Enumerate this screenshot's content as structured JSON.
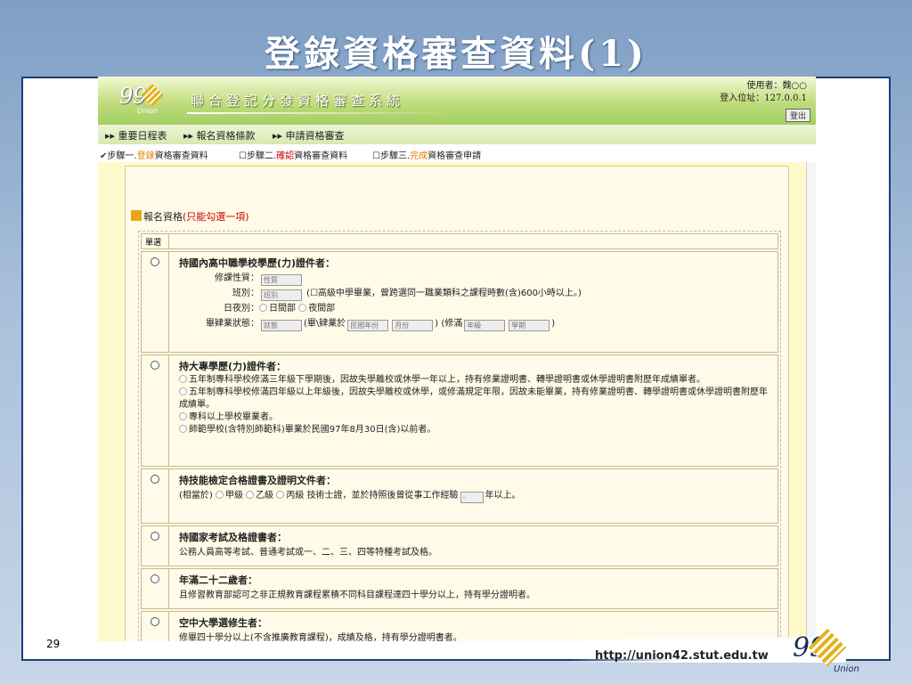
{
  "slide": {
    "title": "登錄資格審查資料(1)",
    "page_number": "29",
    "url": "http://union42.stut.edu.tw",
    "logo_number": "99",
    "logo_text": "Union"
  },
  "app": {
    "logo_number": "99",
    "logo_text": "Union",
    "system_title": "聯合登記分發資格審查系統",
    "user_label": "使用者：魏○○",
    "ip_label": "登入位址：",
    "ip_value": "127.0.0.1",
    "logout": "登出"
  },
  "menu": {
    "items": [
      "重要日程表",
      "報名資格條款",
      "申請資格審查"
    ]
  },
  "steps": {
    "step1_prefix": "步驟一.",
    "step1_hl": "登錄",
    "step1_suffix": "資格審查資料",
    "step2_prefix": "步驟二.",
    "step2_hl": "確認",
    "step2_suffix": "資格審查資料",
    "step3_prefix": "步驟三.",
    "step3_hl": "完成",
    "step3_suffix": "資格審查申請"
  },
  "form": {
    "section_label": "報名資格",
    "section_note": "(只能勾選一項)",
    "col_select": "單選",
    "rows": [
      {
        "title": "持國內高中職學校學歷(力)證件者：",
        "f1_label": "修課性質：",
        "f1_dd": "性質",
        "f2_label": "班別：",
        "f2_dd": "班別",
        "f2_note": "高級中學畢業，曾跨選同一職業類科之課程時數(含)600小時以上。",
        "f3_label": "日夜別：",
        "f3_opt1": "日間部",
        "f3_opt2": "夜間部",
        "f4_label": "畢肄業狀態：",
        "f4_dd": "狀態",
        "f4_mid": "(畢\\肄業於",
        "f4_year": "民國年份",
        "f4_month": "月份",
        "f4_mid2": ") (修滿",
        "f4_grade": "年級",
        "f4_term": "學期"
      },
      {
        "title": "持大專學歷(力)證件者：",
        "o1": "五年制專科學校修滿三年級下學期後，因故失學離校或休學一年以上，持有修業證明書、轉學證明書或休學證明書附歷年成績單者。",
        "o2": "五年制專科學校修滿四年級以上年級後，因故失學離校或休學，或修滿規定年限，因故未能畢業，持有修業證明書、轉學證明書或休學證明書附歷年成績單。",
        "o3": "專科以上學校畢業者。",
        "o4": "師範學校(含特別師範科)畢業於民國97年8月30日(含)以前者。"
      },
      {
        "title": "持技能檢定合格證書及證明文件者：",
        "prefix": "(相當於)",
        "opt1": "甲級",
        "opt2": "乙級",
        "opt3": "丙級",
        "mid": "技術士證，並於持照後曾從事工作經驗",
        "dd": "-",
        "suffix": "年以上。"
      },
      {
        "title": "持國家考試及格證書者：",
        "text": "公務人員高等考試、普通考試或一、二、三、四等特種考試及格。"
      },
      {
        "title": "年滿二十二歲者：",
        "text": "且修習教育部認可之非正規教育課程累積不同科目課程達四十學分以上，持有學分證明者。"
      },
      {
        "title": "空中大學選修生者：",
        "text": "修畢四十學分以上(不含推廣教育課程)，成績及格，持有學分證明書者。"
      }
    ]
  }
}
